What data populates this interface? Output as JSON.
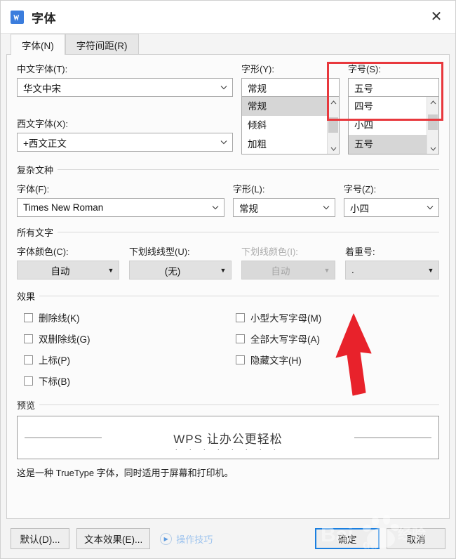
{
  "window": {
    "title": "字体",
    "app_icon": "wps-writer-icon",
    "close_label": "✕"
  },
  "tabs": [
    {
      "label": "字体(N)",
      "active": true
    },
    {
      "label": "字符间距(R)",
      "active": false
    }
  ],
  "latin_section": {
    "chinese_font": {
      "label": "中文字体(T):",
      "value": "华文中宋"
    },
    "western_font": {
      "label": "西文字体(X):",
      "value": "+西文正文"
    },
    "font_style": {
      "label": "字形(Y):",
      "value": "常规",
      "options": [
        "常规",
        "倾斜",
        "加粗"
      ],
      "selected": "常规"
    },
    "font_size": {
      "label": "字号(S):",
      "value": "五号",
      "options": [
        "四号",
        "小四",
        "五号"
      ],
      "selected": "五号"
    }
  },
  "complex_script": {
    "group_title": "复杂文种",
    "font": {
      "label": "字体(F):",
      "value": "Times New Roman"
    },
    "style": {
      "label": "字形(L):",
      "value": "常规"
    },
    "size": {
      "label": "字号(Z):",
      "value": "小四"
    }
  },
  "all_text": {
    "group_title": "所有文字",
    "font_color": {
      "label": "字体颜色(C):",
      "value": "自动",
      "disabled": false
    },
    "underline_style": {
      "label": "下划线线型(U):",
      "value": "(无)",
      "disabled": false
    },
    "underline_color": {
      "label": "下划线颜色(I):",
      "value": "自动",
      "disabled": true
    },
    "emphasis_mark": {
      "label": "着重号:",
      "value": ".",
      "disabled": false,
      "highlight_color": "#e8383d"
    }
  },
  "effects": {
    "group_title": "效果",
    "left_column": [
      {
        "label": "删除线(K)",
        "checked": false
      },
      {
        "label": "双删除线(G)",
        "checked": false
      },
      {
        "label": "上标(P)",
        "checked": false
      },
      {
        "label": "下标(B)",
        "checked": false
      }
    ],
    "right_column": [
      {
        "label": "小型大写字母(M)",
        "checked": false
      },
      {
        "label": "全部大写字母(A)",
        "checked": false
      },
      {
        "label": "隐藏文字(H)",
        "checked": false
      }
    ]
  },
  "preview": {
    "group_title": "预览",
    "sample_text": "WPS 让办公更轻松",
    "emphasis_dots": ". . . . . . . .",
    "note": "这是一种 TrueType 字体，同时适用于屏幕和打印机。"
  },
  "footer": {
    "default_button": "默认(D)...",
    "text_effects_button": "文本效果(E)...",
    "tips_link": "操作技巧",
    "ok_button": "确定",
    "cancel_button": "取消"
  },
  "watermark": {
    "text": "Baidu 经验"
  }
}
